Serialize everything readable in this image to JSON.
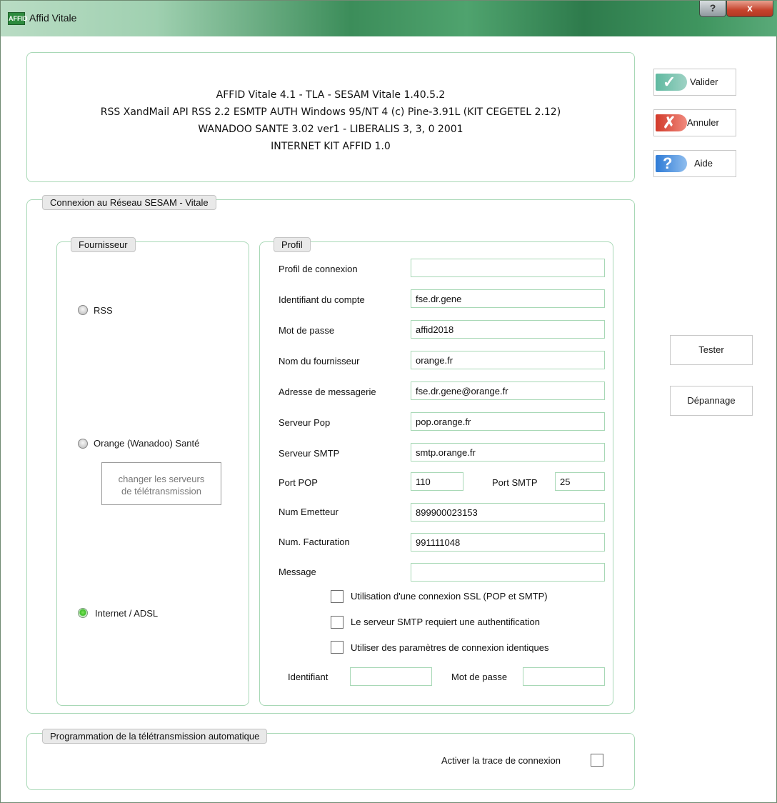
{
  "window": {
    "title": "Affid Vitale",
    "icon_text": "AFFID",
    "help_button": "?",
    "close_button": "x"
  },
  "info": {
    "lines": [
      "AFFID Vitale 4.1 - TLA - SESAM Vitale 1.40.5.2",
      "RSS XandMail API RSS 2.2 ESMTP AUTH Windows 95/NT 4 (c) Pine-3.91L (KIT CEGETEL 2.12)",
      "WANADOO SANTE 3.02 ver1 - LIBERALIS 3, 3, 0 2001",
      "INTERNET KIT AFFID 1.0"
    ]
  },
  "actions": {
    "valider": "Valider",
    "annuler": "Annuler",
    "aide": "Aide",
    "tester": "Tester",
    "depannage": "Dépannage"
  },
  "connexion": {
    "legend": "Connexion au Réseau SESAM - Vitale",
    "fournisseur": {
      "legend": "Fournisseur",
      "options": [
        {
          "label": "RSS",
          "selected": false
        },
        {
          "label": "Orange (Wanadoo) Santé",
          "selected": false
        },
        {
          "label": "Internet / ADSL",
          "selected": true
        }
      ],
      "change_servers_button": [
        "changer les serveurs",
        "de télétransmission"
      ]
    },
    "profil": {
      "legend": "Profil",
      "fields": [
        {
          "label": "Profil de connexion",
          "value": ""
        },
        {
          "label": "Identifiant du compte",
          "value": "fse.dr.gene"
        },
        {
          "label": "Mot de passe",
          "value": "affid2018"
        },
        {
          "label": "Nom du fournisseur",
          "value": "orange.fr"
        },
        {
          "label": "Adresse de messagerie",
          "value": "fse.dr.gene@orange.fr"
        },
        {
          "label": "Serveur Pop",
          "value": "pop.orange.fr"
        },
        {
          "label": "Serveur SMTP",
          "value": "smtp.orange.fr"
        }
      ],
      "port_pop": {
        "label": "Port POP",
        "value": "110"
      },
      "port_smtp": {
        "label": "Port SMTP",
        "value": "25"
      },
      "num_emetteur": {
        "label": "Num Emetteur",
        "value": "899900023153"
      },
      "num_facturation": {
        "label": "Num. Facturation",
        "value": "991111048"
      },
      "message": {
        "label": "Message",
        "value": ""
      },
      "checkboxes": [
        {
          "label": "Utilisation d'une connexion SSL (POP et SMTP)",
          "checked": false
        },
        {
          "label": "Le serveur SMTP requiert une authentification",
          "checked": false
        },
        {
          "label": "Utiliser des paramètres de connexion identiques",
          "checked": false
        }
      ],
      "identifiant": {
        "label": "Identifiant",
        "value": ""
      },
      "mot_de_passe": {
        "label": "Mot de passe",
        "value": ""
      }
    }
  },
  "programmation": {
    "legend": "Programmation de la télétransmission automatique",
    "trace": {
      "label": "Activer la trace de connexion",
      "checked": false
    }
  },
  "colors": {
    "panel_border": "#a8d8b6",
    "radio_selected": "#3fbf2a",
    "close_button": "#c5432c"
  }
}
